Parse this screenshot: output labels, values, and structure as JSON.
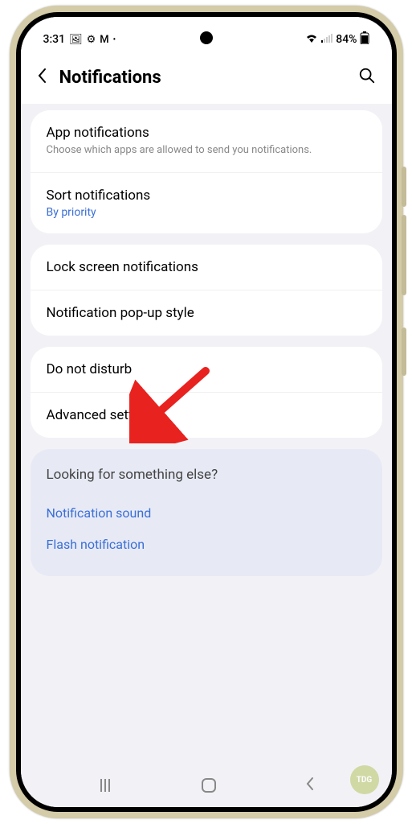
{
  "statusbar": {
    "time": "3:31",
    "battery": "84%"
  },
  "header": {
    "title": "Notifications"
  },
  "sections": [
    {
      "items": [
        {
          "title": "App notifications",
          "subtitle": "Choose which apps are allowed to send you notifications."
        },
        {
          "title": "Sort notifications",
          "sublink": "By priority"
        }
      ]
    },
    {
      "items": [
        {
          "title": "Lock screen notifications"
        },
        {
          "title": "Notification pop-up style"
        }
      ]
    },
    {
      "items": [
        {
          "title": "Do not disturb"
        },
        {
          "title": "Advanced settings"
        }
      ]
    }
  ],
  "help": {
    "title": "Looking for something else?",
    "links": [
      "Notification sound",
      "Flash notification"
    ]
  },
  "badge": "TDG"
}
